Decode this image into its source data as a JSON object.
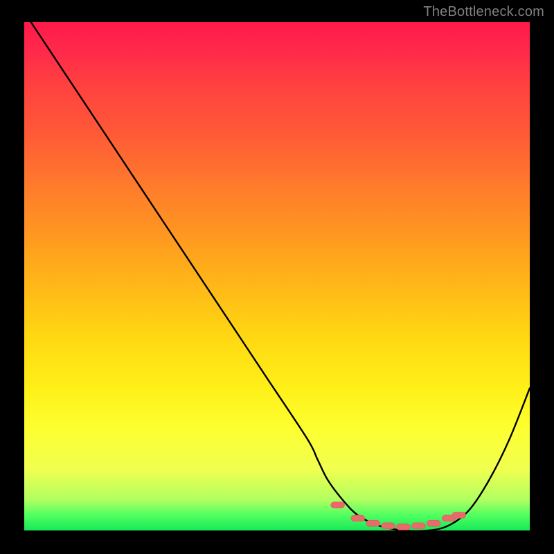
{
  "watermark": "TheBottleneck.com",
  "chart_data": {
    "type": "line",
    "title": "",
    "xlabel": "",
    "ylabel": "",
    "xlim": [
      0,
      100
    ],
    "ylim": [
      0,
      100
    ],
    "background": "rainbow-vertical-gradient",
    "series": [
      {
        "name": "bottleneck-curve",
        "x": [
          0,
          8,
          16,
          24,
          32,
          40,
          48,
          56,
          58,
          60,
          63,
          66,
          70,
          75,
          80,
          84,
          88,
          92,
          96,
          100
        ],
        "values": [
          102,
          90,
          78,
          66,
          54,
          42,
          30,
          18,
          14,
          10,
          6,
          3,
          1,
          0,
          0,
          1,
          4,
          10,
          18,
          28
        ]
      }
    ],
    "markers": {
      "name": "valley-highlight",
      "color": "#e86a6a",
      "shape": "rounded-rect",
      "points": [
        {
          "x": 62,
          "y": 5
        },
        {
          "x": 66,
          "y": 2.4
        },
        {
          "x": 69,
          "y": 1.4
        },
        {
          "x": 72,
          "y": 0.9
        },
        {
          "x": 75,
          "y": 0.7
        },
        {
          "x": 78,
          "y": 0.9
        },
        {
          "x": 81,
          "y": 1.4
        },
        {
          "x": 84,
          "y": 2.4
        },
        {
          "x": 86,
          "y": 3.0
        }
      ]
    }
  }
}
